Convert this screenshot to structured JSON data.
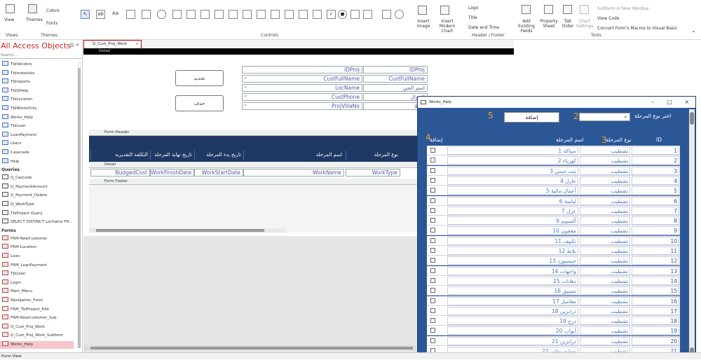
{
  "ribbon": {
    "view": "View",
    "themes": "Themes",
    "colors": "Colors",
    "fonts": "Fonts",
    "group_views": "Views",
    "group_themes": "Themes",
    "group_controls": "Controls",
    "insert_image": "Insert Image",
    "insert_chart": "Insert Modern Chart",
    "logo": "Logo",
    "title": "Title",
    "date_time": "Date and Time",
    "group_header": "Header / Footer",
    "add_fields": "Add Existing Fields",
    "property_sheet": "Property Sheet",
    "tab_order": "Tab Order",
    "chart_settings": "Chart Settings",
    "subform_new": "Subform in New Window",
    "view_code": "View Code",
    "convert_macros": "Convert Form's Macros to Visual Basic",
    "group_tools": "Tools"
  },
  "nav": {
    "title": "All Access Objects",
    "search": "Search...",
    "tables": [
      "TblVendors",
      "Tblmaterials",
      "Tblreports",
      "TblQHelp",
      "TblLocation",
      "TblWorksOnly",
      "Works_Help",
      "TblLoan",
      "LoanPayment",
      "Users",
      "Casecade",
      "Help"
    ],
    "queries_label": "Queries",
    "queries": [
      "Q_Cascade",
      "Q_PaymentAmount",
      "Q_Payment_Delete",
      "Q_WorkType",
      "TblProject Query",
      "SELECT DISTINCT Lochame FR..."
    ],
    "forms_label": "Forms",
    "forms": [
      "FRM-NewCustomer",
      "FRM-Location",
      "Loan",
      "FRM_LoanPayment",
      "TblLoan",
      "Login",
      "Main_Menu",
      "Navigation_Form",
      "FRM_TblProject_Edit",
      "FRM-NewCustomer_Sub",
      "Q_Cust_Proj_Work",
      "Q_Cust_Proj_Work_Subform",
      "Works_Help"
    ]
  },
  "doc": {
    "tab": "Q_Cust_Proj_Work",
    "detail_band": "Detail",
    "form_header_band": "Form Header",
    "detail_band2": "Detail",
    "form_footer_band": "Form Footer",
    "btn_update": "تحديد",
    "btn_delete": "حذف",
    "fields": [
      {
        "left": "IDProj",
        "right": "IDProj"
      },
      {
        "left": "CustFullName",
        "right": "CustFullName"
      },
      {
        "left": "LocName",
        "right": "اسم الحي"
      },
      {
        "left": "CustPhone",
        "right": "الجوال"
      },
      {
        "left": "ProjVillaNo",
        "right": "الفيلا"
      }
    ],
    "headers": [
      "نوع المرحلة",
      "اسم المرحلة",
      "تاريخ بدء المرحلة",
      "تاريخ نهاية المرحلة",
      "التكلفة التقديرية"
    ],
    "detail_fields": [
      "WorkType",
      "WorkName",
      "WorkStartDate",
      "WorkFinishDate",
      "BudgedCost"
    ]
  },
  "popup": {
    "title": "Works_Help",
    "choose_label": "اختر نوع المرحلة",
    "add_button": "إضافة",
    "col_id": "ID",
    "col_type": "نوع المرحلة",
    "col_name": "اسم المرحلة",
    "col_add": "إضافة",
    "num1": "2",
    "num2": "3",
    "num3": "4",
    "num4": "5",
    "rows": [
      {
        "id": "1",
        "type": "تشطيب",
        "name": "1 سباكة"
      },
      {
        "id": "2",
        "type": "تشطيب",
        "name": "2 كهرباء"
      },
      {
        "id": "3",
        "type": "تشطيب",
        "name": "3 تبت جبس"
      },
      {
        "id": "4",
        "type": "تشطيب",
        "name": "4 عازل"
      },
      {
        "id": "5",
        "type": "تشطيب",
        "name": "5 أعمال مالية"
      },
      {
        "id": "6",
        "type": "تشطيب",
        "name": "6 لياسة"
      },
      {
        "id": "7",
        "type": "تشطيب",
        "name": "7 عزل"
      },
      {
        "id": "8",
        "type": "تشطيب",
        "name": "9 ألمنيوم"
      },
      {
        "id": "9",
        "type": "تشطيب",
        "name": "10 معجون"
      },
      {
        "id": "10",
        "type": "تشطيب",
        "name": "11 تكييف"
      },
      {
        "id": "11",
        "type": "تشطيب",
        "name": "12 بلاط"
      },
      {
        "id": "12",
        "type": "تشطيب",
        "name": "13 جبسبورد"
      },
      {
        "id": "13",
        "type": "تشطيب",
        "name": "14 واجهات"
      },
      {
        "id": "14",
        "type": "تشطيب",
        "name": "15 دهانات"
      },
      {
        "id": "15",
        "type": "تشطيب",
        "name": "16 تنسيق"
      },
      {
        "id": "16",
        "type": "تشطيب",
        "name": "17 مغاسل"
      },
      {
        "id": "17",
        "type": "تشطيب",
        "name": "18 درابزين"
      },
      {
        "id": "18",
        "type": "تشطيب",
        "name": "19 درج"
      },
      {
        "id": "19",
        "type": "تشطيب",
        "name": "20 أبواب"
      },
      {
        "id": "20",
        "type": "تشطيب",
        "name": "21 درابزين"
      },
      {
        "id": "21",
        "type": "تشطيب",
        "name": "22 تسليم نهائي"
      }
    ]
  },
  "status": "Form View"
}
